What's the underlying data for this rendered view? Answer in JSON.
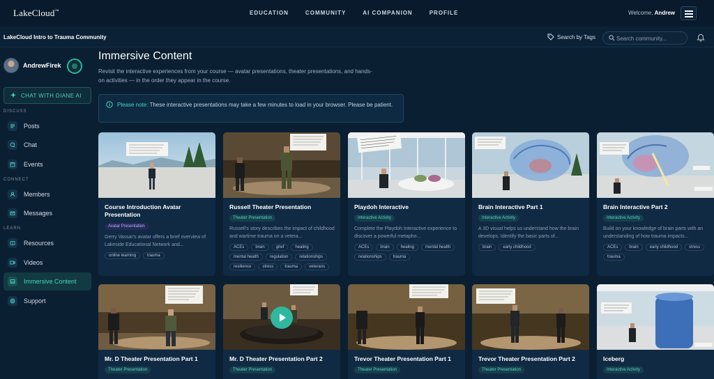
{
  "brand": {
    "name": "LakeCloud",
    "tm": "™"
  },
  "nav": {
    "links": [
      "EDUCATION",
      "COMMUNITY",
      "AI COMPANION",
      "PROFILE"
    ],
    "welcome_prefix": "Welcome,",
    "welcome_user": "Andrew"
  },
  "subbar": {
    "community": "LakeCloud Intro to Trauma Community",
    "tags_label": "Search by Tags",
    "search_placeholder": "Search community..."
  },
  "sidebar": {
    "username": "AndrewFirek",
    "chat_ai": "CHAT WITH DIANE AI",
    "sections": {
      "discuss": "DISCUSS",
      "connect": "CONNECT",
      "learn": "LEARN"
    },
    "items": {
      "posts": "Posts",
      "chat": "Chat",
      "events": "Events",
      "members": "Members",
      "messages": "Messages",
      "resources": "Resources",
      "videos": "Videos",
      "immersive": "Immersive Content",
      "support": "Support"
    }
  },
  "main": {
    "title": "Immersive Content",
    "description": "Revisit the interactive experiences from your course — avatar presentations, theater presentations, and hands-on activities — in the order they appear in the course.",
    "notice_label": "Please note:",
    "notice_text": "These interactive presentations may take a few minutes to load in your browser. Please be patient."
  },
  "cards": [
    {
      "title": "Course Introduction Avatar Presentation",
      "badge": "Avatar Presentation",
      "desc": "Gerry Vassar's avatar offers a brief overview of Lakeside Educational Network and...",
      "tags": [
        "online learning",
        "trauma"
      ]
    },
    {
      "title": "Russell Theater Presentation",
      "badge": "Theater Presentation",
      "desc": "Russell's story describes the impact of childhood and wartime trauma on a vetera...",
      "tags": [
        "ACEs",
        "brain",
        "grief",
        "healing",
        "mental health",
        "regulation",
        "relationships",
        "resilience",
        "stress",
        "trauma",
        "veterans"
      ]
    },
    {
      "title": "Playdoh Interactive",
      "badge": "Interactive Activity",
      "desc": "Complete the Playdoh Interactive experience to discover a powerful metapho...",
      "tags": [
        "ACEs",
        "brain",
        "healing",
        "mental health",
        "relationships",
        "trauma"
      ]
    },
    {
      "title": "Brain Interactive Part 1",
      "badge": "Interactive Activity",
      "desc": "A 3D visual helps us understand how the brain develops. Identify the basic parts of...",
      "tags": [
        "brain",
        "early childhood"
      ]
    },
    {
      "title": "Brain Interactive Part 2",
      "badge": "Interactive Activity",
      "desc": "Build on your knowledge of brain parts with an understanding of how trauma impacts...",
      "tags": [
        "ACEs",
        "brain",
        "early childhood",
        "stress",
        "trauma"
      ]
    },
    {
      "title": "Mr. D Theater Presentation Part 1",
      "badge": "Theater Presentation"
    },
    {
      "title": "Mr. D Theater Presentation Part 2",
      "badge": "Theater Presentation"
    },
    {
      "title": "Trevor Theater Presentation Part 1",
      "badge": "Theater Presentation"
    },
    {
      "title": "Trevor Theater Presentation Part 2",
      "badge": "Theater Presentation"
    },
    {
      "title": "Iceberg",
      "badge": "Interactive Activity"
    }
  ],
  "colors": {
    "bg": "#0b1f33",
    "accent": "#4ad3bd",
    "card": "#102a44"
  }
}
